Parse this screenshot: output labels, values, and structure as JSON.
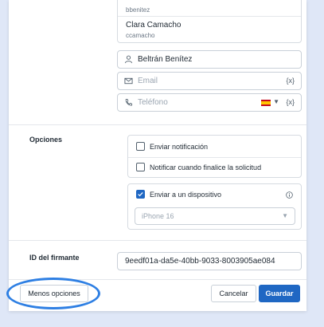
{
  "suggestions": {
    "top_username": "bbenitez",
    "name": "Clara Camacho",
    "username": "ccamacho"
  },
  "signer": {
    "name_value": "Beltrán Benítez",
    "email_placeholder": "Email",
    "phone_placeholder": "Teléfono",
    "variable_token": "{x}"
  },
  "options": {
    "title": "Opciones",
    "send_notification": "Enviar notificación",
    "notify_when_done": "Notificar cuando finalice la solicitud",
    "send_to_device": "Enviar a un dispositivo",
    "device_selected": "iPhone 16"
  },
  "signer_id": {
    "label": "ID del firmante",
    "value": "9eedf01a-da5e-40bb-9033-8003905ae084"
  },
  "footer": {
    "less_options": "Menos opciones",
    "cancel": "Cancelar",
    "save": "Guardar"
  },
  "colors": {
    "primary": "#1f67c3",
    "annotation": "#2e7fe3",
    "flag_red": "#c60b1e",
    "flag_yellow": "#ffc400"
  }
}
